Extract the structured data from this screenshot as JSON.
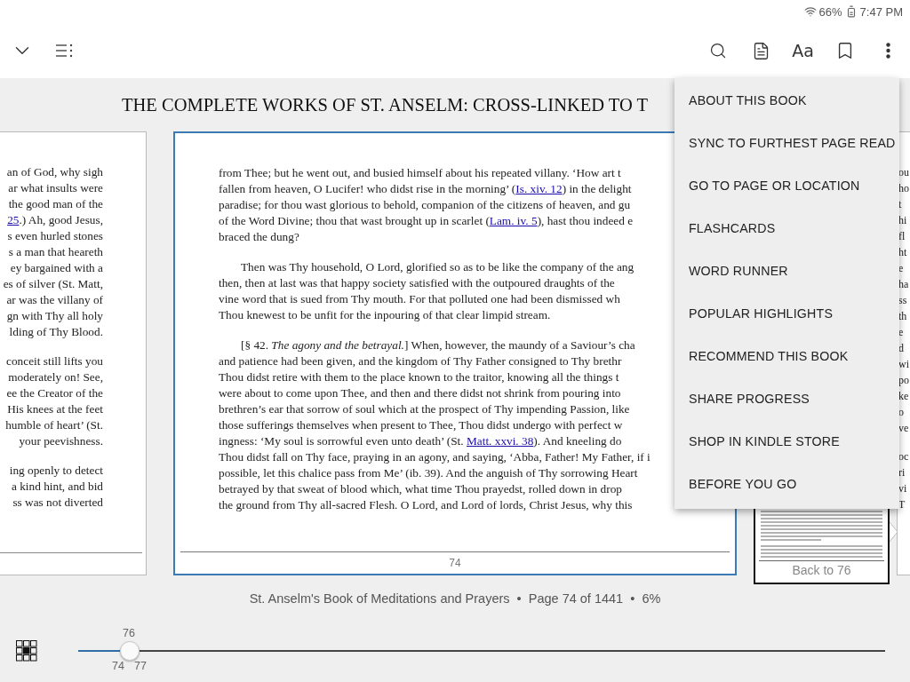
{
  "status_bar": {
    "battery": "66%",
    "time": "7:47 PM"
  },
  "toolbar": {
    "font_button": "Aa"
  },
  "book_title": "THE COMPLETE WORKS OF ST. ANSELM: CROSS-LINKED TO T",
  "left_page": {
    "paragraphs": [
      {
        "lines": [
          {
            "parts": [
              {
                "kind": "text",
                "text": "an of God, why sigh"
              }
            ]
          },
          {
            "parts": [
              {
                "kind": "text",
                "text": "ar what insults were"
              }
            ]
          },
          {
            "parts": [
              {
                "kind": "text",
                "text": "the good man of the"
              }
            ]
          },
          {
            "parts": [
              {
                "kind": "link",
                "text": "25"
              },
              {
                "kind": "text",
                "text": ".) Ah, good Jesus,"
              }
            ]
          },
          {
            "parts": [
              {
                "kind": "text",
                "text": "s even hurled stones"
              }
            ]
          },
          {
            "parts": [
              {
                "kind": "text",
                "text": "s a man that heareth"
              }
            ]
          },
          {
            "parts": [
              {
                "kind": "text",
                "text": "ey bargained with a"
              }
            ]
          },
          {
            "parts": [
              {
                "kind": "text",
                "text": "es of silver (St. Matt,"
              }
            ]
          },
          {
            "parts": [
              {
                "kind": "text",
                "text": "ar was the villany of"
              }
            ]
          },
          {
            "parts": [
              {
                "kind": "text",
                "text": "gn with Thy all holy"
              }
            ]
          },
          {
            "parts": [
              {
                "kind": "text",
                "text": "lding of Thy Blood."
              }
            ]
          }
        ]
      },
      {
        "lines": [
          {
            "parts": [
              {
                "kind": "text",
                "text": "conceit still lifts you"
              }
            ]
          },
          {
            "parts": [
              {
                "kind": "text",
                "text": "moderately on! See,"
              }
            ]
          },
          {
            "parts": [
              {
                "kind": "text",
                "text": "ee the Creator of the"
              }
            ]
          },
          {
            "parts": [
              {
                "kind": "text",
                "text": "His knees at the feet"
              }
            ]
          },
          {
            "parts": [
              {
                "kind": "text",
                "text": "humble of heart’ (St."
              }
            ]
          },
          {
            "parts": [
              {
                "kind": "text",
                "text": "your peevishness."
              }
            ]
          }
        ]
      },
      {
        "lines": [
          {
            "parts": [
              {
                "kind": "text",
                "text": "ing openly to detect"
              }
            ]
          },
          {
            "parts": [
              {
                "kind": "text",
                "text": "a kind hint, and bid"
              }
            ]
          },
          {
            "parts": [
              {
                "kind": "text",
                "text": "ss was not diverted"
              }
            ]
          }
        ]
      }
    ]
  },
  "center_page": {
    "page_number": "74",
    "paragraphs": [
      {
        "indented": false,
        "lines": [
          {
            "parts": [
              {
                "kind": "text",
                "text": "from Thee; but he went out, and busied himself about his repeated villany. ‘How art t"
              }
            ]
          },
          {
            "parts": [
              {
                "kind": "text",
                "text": "fallen from heaven, O Lucifer! who didst rise in the morning’ ("
              },
              {
                "kind": "link",
                "text": "Is. xiv. 12"
              },
              {
                "kind": "text",
                "text": ") in the delight"
              }
            ]
          },
          {
            "parts": [
              {
                "kind": "text",
                "text": "paradise; for thou wast glorious to behold, companion of the citizens of heaven, and gu"
              }
            ]
          },
          {
            "parts": [
              {
                "kind": "text",
                "text": "of the Word Divine; thou that wast brought up in scarlet ("
              },
              {
                "kind": "link",
                "text": "Lam. iv. 5"
              },
              {
                "kind": "text",
                "text": "), hast thou indeed e"
              }
            ]
          },
          {
            "parts": [
              {
                "kind": "text",
                "text": "braced the dung?"
              }
            ]
          }
        ]
      },
      {
        "indented": true,
        "lines": [
          {
            "parts": [
              {
                "kind": "text",
                "text": "Then was Thy household, O Lord, glorified so as to be like the company of the ang"
              }
            ]
          },
          {
            "parts": [
              {
                "kind": "text",
                "text": "then, then at last was that happy society satisfied with the outpoured draughts of the"
              }
            ]
          },
          {
            "parts": [
              {
                "kind": "text",
                "text": "vine word that is sued from Thy mouth. For that polluted one had been dismissed wh"
              }
            ]
          },
          {
            "parts": [
              {
                "kind": "text",
                "text": "Thou knewest to be unfit for the inpouring of that clear limpid stream."
              }
            ]
          }
        ]
      },
      {
        "indented": true,
        "lines": [
          {
            "parts": [
              {
                "kind": "text",
                "text": "[§ 42. *The agony and the betrayal.*] When, however, the maundy of a Saviour’s cha"
              }
            ]
          },
          {
            "parts": [
              {
                "kind": "text",
                "text": "and patience had been given, and the kingdom of Thy Father consigned to Thy brethr"
              }
            ]
          },
          {
            "parts": [
              {
                "kind": "text",
                "text": "Thou didst retire with them to the place known to the traitor, knowing all the things t"
              }
            ]
          },
          {
            "parts": [
              {
                "kind": "text",
                "text": "were about to come upon Thee, and then and there didst not shrink from pouring into"
              }
            ]
          },
          {
            "parts": [
              {
                "kind": "text",
                "text": "brethren’s ear that sorrow of soul which at the prospect of Thy impending Passion, like"
              }
            ]
          },
          {
            "parts": [
              {
                "kind": "text",
                "text": "those sufferings themselves when present to Thee, Thou didst undergo with perfect w"
              }
            ]
          },
          {
            "parts": [
              {
                "kind": "text",
                "text": "ingness: ‘My soul is sorrowful even unto death’ (St. "
              },
              {
                "kind": "link",
                "text": "Matt. xxvi. 38"
              },
              {
                "kind": "text",
                "text": "). And kneeling do"
              }
            ]
          },
          {
            "parts": [
              {
                "kind": "text",
                "text": "Thou didst fall on Thy face, praying in an agony, and saying, ‘Abba, Father! My Father, if i"
              }
            ]
          },
          {
            "parts": [
              {
                "kind": "text",
                "text": "possible, let this chalice pass from Me’ (ib. 39). And the anguish of Thy sorrowing Heart"
              }
            ]
          },
          {
            "parts": [
              {
                "kind": "text",
                "text": "betrayed by that sweat of blood which, what time Thou prayedst, rolled down in drop"
              }
            ]
          },
          {
            "parts": [
              {
                "kind": "text",
                "text": "the ground from Thy all-sacred Flesh. O Lord, and Lord of lords, Christ Jesus, why this"
              }
            ]
          }
        ]
      }
    ]
  },
  "right_page": {
    "paragraphs": [
      [
        "ou",
        "ho",
        "t",
        "hi",
        "fl",
        "ht",
        "e",
        "ha",
        "ss",
        "th",
        "e",
        "d",
        "wi",
        "po",
        "ke",
        "o",
        "ve"
      ],
      [
        "oc",
        "ri",
        "vi",
        "T"
      ]
    ]
  },
  "menu": {
    "items": [
      "ABOUT THIS BOOK",
      "SYNC TO FURTHEST PAGE READ",
      "GO TO PAGE OR LOCATION",
      "FLASHCARDS",
      "WORD RUNNER",
      "POPULAR HIGHLIGHTS",
      "RECOMMEND THIS BOOK",
      "SHARE PROGRESS",
      "SHOP IN KINDLE STORE",
      "BEFORE YOU GO"
    ]
  },
  "thumbnail": {
    "label": "Back to 76"
  },
  "footer": {
    "info": "St. Anselm's Book of Meditations and Prayers  •  Page 74 of 1441  •  6%"
  },
  "slider": {
    "level": 0.064,
    "label_above": "76",
    "labels_below": [
      "74",
      "77"
    ]
  }
}
